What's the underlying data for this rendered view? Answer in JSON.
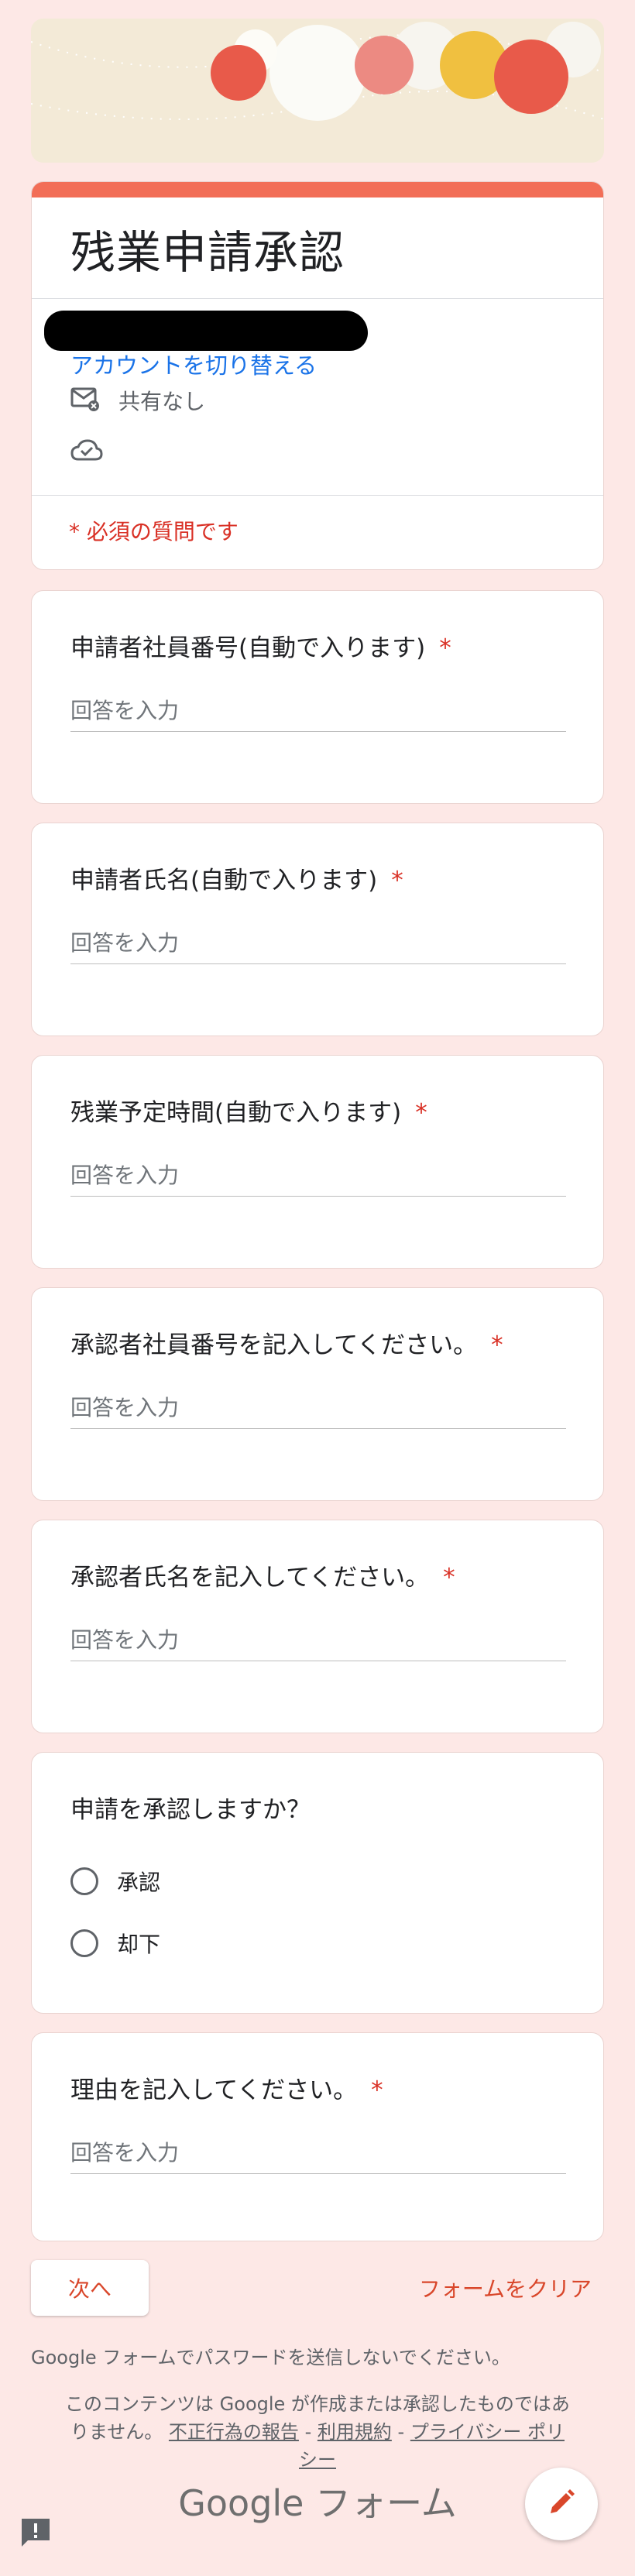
{
  "form": {
    "title": "残業申請承認",
    "switch_account": "アカウントを切り替える",
    "share_status": "共有なし",
    "required_note": "* 必須の質問です"
  },
  "questions": [
    {
      "title": "申請者社員番号(自動で入ります)",
      "required": "*",
      "placeholder": "回答を入力"
    },
    {
      "title": "申請者氏名(自動で入ります)",
      "required": "*",
      "placeholder": "回答を入力"
    },
    {
      "title": "残業予定時間(自動で入ります)",
      "required": "*",
      "placeholder": "回答を入力"
    },
    {
      "title": "承認者社員番号を記入してください。",
      "required": "*",
      "placeholder": "回答を入力"
    },
    {
      "title": "承認者氏名を記入してください。",
      "required": "*",
      "placeholder": "回答を入力"
    },
    {
      "title": "申請を承認しますか？",
      "options": [
        "承認",
        "却下"
      ]
    },
    {
      "title": "理由を記入してください。",
      "required": "*",
      "placeholder": "回答を入力"
    }
  ],
  "controls": {
    "next": "次へ",
    "clear": "フォームをクリア"
  },
  "footer": {
    "password_warning": "Google フォームでパスワードを送信しないでください。",
    "disclaimer_text": "このコンテンツは Google が作成または承認したものではありません。",
    "report_link": "不正行為の報告",
    "terms_link": "利用規約",
    "privacy_link": "プライバシー ポリシー",
    "separator": "-",
    "brand": "Google フォーム"
  },
  "icons": {
    "mail": "mail-not-shared-icon",
    "cloud": "cloud-saved-icon",
    "report": "report-problem-icon",
    "edit": "edit-pencil-icon"
  },
  "colors": {
    "accent": "#f26e57",
    "background": "#fde8e6",
    "required": "#d93025",
    "link": "#1a73e8",
    "action": "#d9472b"
  }
}
